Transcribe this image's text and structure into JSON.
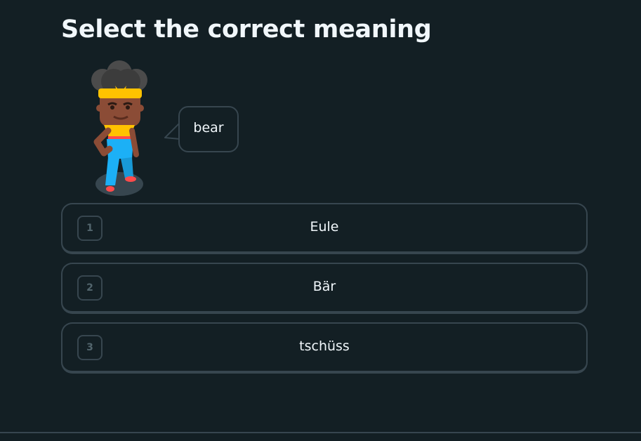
{
  "header": {
    "title": "Select the correct meaning"
  },
  "prompt": {
    "character_icon": "character-illustration",
    "speech_text": "bear"
  },
  "choices": [
    {
      "number": "1",
      "label": "Eule"
    },
    {
      "number": "2",
      "label": "Bär"
    },
    {
      "number": "3",
      "label": "tschüss"
    }
  ],
  "colors": {
    "background": "#131f24",
    "border": "#37464f",
    "text": "#f1f7fb",
    "muted": "#52656d"
  }
}
